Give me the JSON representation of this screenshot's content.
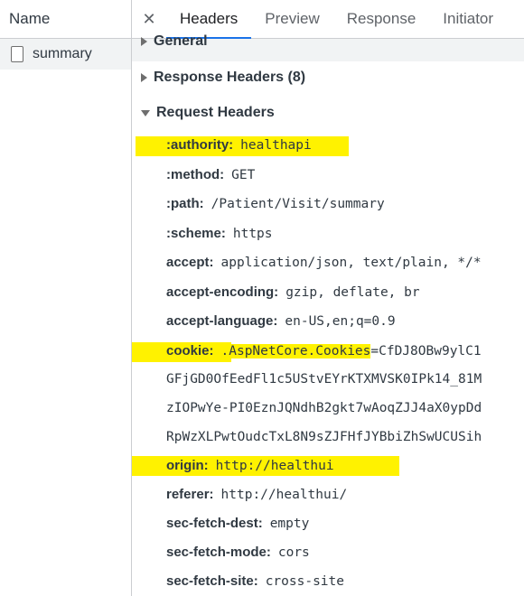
{
  "name_panel": {
    "column_header": "Name",
    "request": {
      "name": "summary",
      "icon": "document-icon"
    }
  },
  "tabs": {
    "close_icon": "close-icon",
    "items": [
      "Headers",
      "Preview",
      "Response",
      "Initiator"
    ],
    "active": "Headers"
  },
  "sections": {
    "general": "General",
    "response_headers": "Response Headers (8)",
    "request_headers": "Request Headers"
  },
  "request_headers": [
    {
      "name": ":authority:",
      "value": "healthapi"
    },
    {
      "name": ":method:",
      "value": "GET"
    },
    {
      "name": ":path:",
      "value": "/Patient/Visit/summary"
    },
    {
      "name": ":scheme:",
      "value": "https"
    },
    {
      "name": "accept:",
      "value": "application/json, text/plain, */*"
    },
    {
      "name": "accept-encoding:",
      "value": "gzip, deflate, br"
    },
    {
      "name": "accept-language:",
      "value": "en-US,en;q=0.9"
    },
    {
      "name": "cookie:",
      "value_highlighted": ".AspNetCore.Cookies",
      "value_rest": "=CfDJ8OBw9ylC1"
    },
    {
      "continuation": "GFjGD0OfEedFl1c5UStvEYrKTXMVSK0IPk14_81M"
    },
    {
      "continuation": "zIOPwYe-PI0EznJQNdhB2gkt7wAoqZJJ4aX0ypDd"
    },
    {
      "continuation": "RpWzXLPwtOudcTxL8N9sZJFHfJYBbiZhSwUCUSih"
    },
    {
      "name": "origin:",
      "value": "http://healthui"
    },
    {
      "name": "referer:",
      "value": "http://healthui/"
    },
    {
      "name": "sec-fetch-dest:",
      "value": "empty"
    },
    {
      "name": "sec-fetch-mode:",
      "value": "cors"
    },
    {
      "name": "sec-fetch-site:",
      "value": "cross-site"
    }
  ],
  "highlight_color": "#fff200",
  "active_tab_color": "#1a73e8"
}
